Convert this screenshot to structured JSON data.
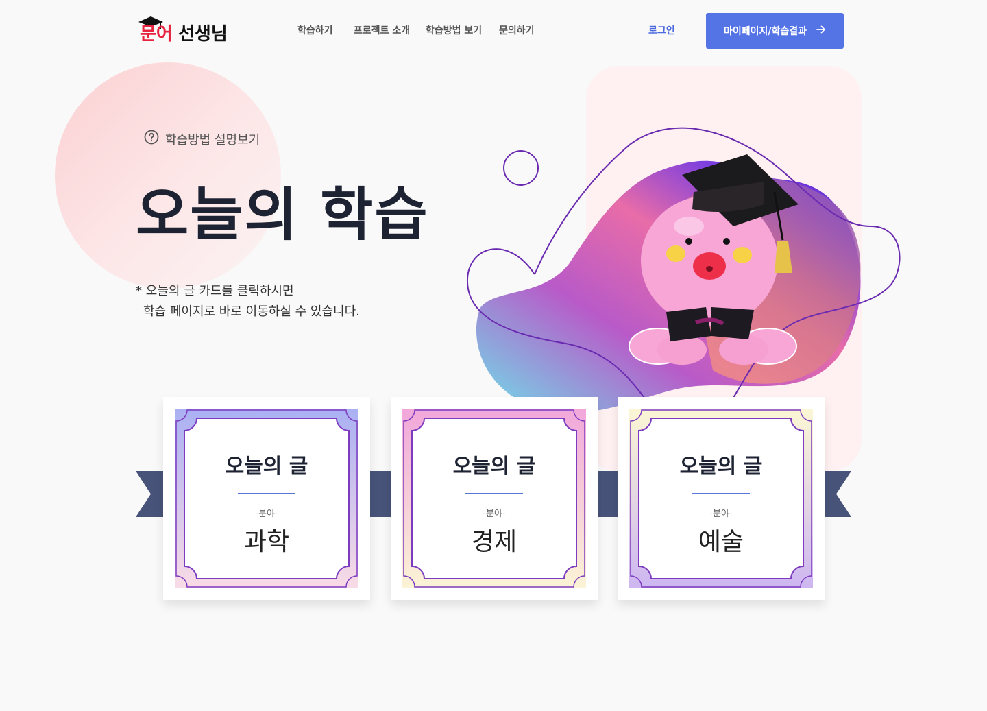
{
  "header": {
    "logo_text": "문어 선생님",
    "nav": [
      "학습하기",
      "프로젝트 소개",
      "학습방법 보기",
      "문의하기"
    ],
    "login_label": "로그인",
    "mypage_label": "마이페이지/학습결과"
  },
  "hero": {
    "help_label": "학습방법 설명보기",
    "title": "오늘의 학습",
    "desc_line1": "* 오늘의 글 카드를 클릭하시면",
    "desc_line2": "학습 페이지로 바로 이동하실 수 있습니다."
  },
  "cards": [
    {
      "title": "오늘의 글",
      "label": "-분야-",
      "field": "과학"
    },
    {
      "title": "오늘의 글",
      "label": "-분야-",
      "field": "경제"
    },
    {
      "title": "오늘의 글",
      "label": "-분야-",
      "field": "예술"
    }
  ],
  "colors": {
    "accent": "#5474e6",
    "ribbon": "#475379",
    "octopus": "#f7a6d6",
    "outline": "#6a2bb0"
  }
}
